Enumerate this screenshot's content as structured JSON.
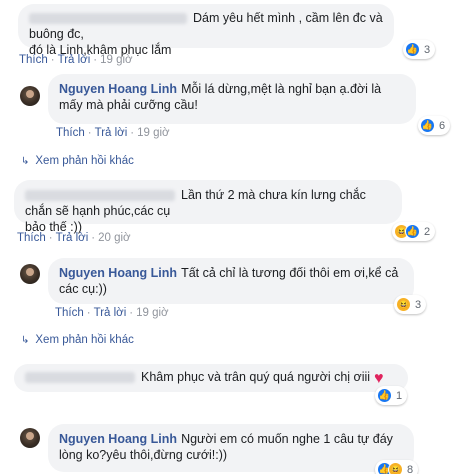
{
  "comments": [
    {
      "text": "Dám yêu hết mình , cầm lên đc và buông đc, đó là Linh,khâm phục lắm",
      "line1": "Dám yêu hết mình , cầm lên đc và buông đc,",
      "line2": "đó là Linh,khâm phục lắm",
      "actions": {
        "like": "Thích",
        "reply": "Trả lời",
        "time": "19 giờ"
      },
      "reaction": {
        "icons": [
          "like-icon"
        ],
        "count": "3"
      }
    },
    {
      "author": "Nguyen Hoang Linh",
      "line1": "Mỗi lá dừng,mệt là nghỉ bạn ạ.đời là",
      "line2": "mấy mà phải cưỡng cầu!",
      "actions": {
        "like": "Thích",
        "reply": "Trả lời",
        "time": "19 giờ"
      },
      "reaction": {
        "icons": [
          "like-icon"
        ],
        "count": "6"
      }
    },
    {
      "more": "Xem phản hồi khác"
    },
    {
      "line1": "Lần thứ 2 mà chưa kín lưng chắc chắn sẽ hạnh phúc,các cụ",
      "line2": "bảo thế :))",
      "actions": {
        "like": "Thích",
        "reply": "Trả lời",
        "time": "20 giờ"
      },
      "reaction": {
        "icons": [
          "haha-icon",
          "like-icon"
        ],
        "count": "2"
      }
    },
    {
      "author": "Nguyen Hoang Linh",
      "line1": "Tất cả chỉ là tương đối thôi em ơi,kể cả",
      "line2": "các cụ:))",
      "actions": {
        "like": "Thích",
        "reply": "Trả lời",
        "time": "19 giờ"
      },
      "reaction": {
        "icons": [
          "haha-icon"
        ],
        "count": "3"
      }
    },
    {
      "more": "Xem phản hồi khác"
    },
    {
      "line1": "Khâm phục và trân quý quá người chị ơiii",
      "reaction": {
        "icons": [
          "like-icon"
        ],
        "count": "1"
      }
    },
    {
      "author": "Nguyen Hoang Linh",
      "line1": "Người em có muốn nghe 1 câu tự đáy",
      "line2": "lòng ko?yêu thôi,đừng cưới!:))",
      "reaction": {
        "icons": [
          "like-icon",
          "haha-icon"
        ],
        "count": "8"
      }
    }
  ],
  "colors": {
    "link": "#385898",
    "bubble": "#f2f3f5",
    "like": "#1877f2",
    "haha": "#f7b125",
    "love": "#e0245e"
  }
}
